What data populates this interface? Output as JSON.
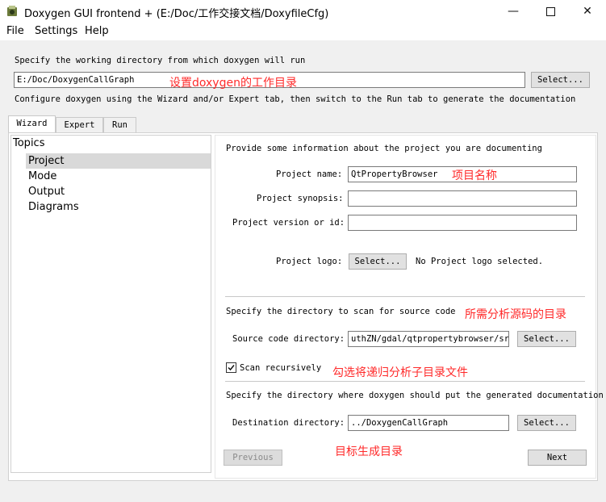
{
  "window": {
    "title": "Doxygen GUI frontend + (E:/Doc/工作交接文档/DoxyfileCfg)"
  },
  "menu": {
    "items": [
      "File",
      "Settings",
      "Help"
    ]
  },
  "workdir": {
    "label": "Specify the working directory from which doxygen will run",
    "value": "E:/Doc/DoxygenCallGraph",
    "select_label": "Select...",
    "annotation": "设置doxygen的工作目录"
  },
  "configure_hint": "Configure doxygen using the Wizard and/or Expert tab, then switch to the Run tab to generate the documentation",
  "tabs": [
    "Wizard",
    "Expert",
    "Run"
  ],
  "topics": {
    "header": "Topics",
    "items": [
      "Project",
      "Mode",
      "Output",
      "Diagrams"
    ]
  },
  "project": {
    "intro": "Provide some information about the project you are documenting",
    "name_label": "Project name:",
    "name_value": "QtPropertyBrowser",
    "name_annotation": "项目名称",
    "synopsis_label": "Project synopsis:",
    "synopsis_value": "",
    "version_label": "Project version or id:",
    "version_value": "",
    "logo_label": "Project logo:",
    "logo_select": "Select...",
    "logo_status": "No Project logo selected."
  },
  "source": {
    "intro": "Specify the directory to scan for source code",
    "annotation": "所需分析源码的目录",
    "label": "Source code directory:",
    "value": "uthZN/gdal/qtpropertybrowser/src",
    "select_label": "Select...",
    "scan_label": "Scan recursively",
    "scan_checked": true,
    "scan_annotation": "勾选将递归分析子目录文件"
  },
  "destination": {
    "intro": "Specify the directory where doxygen should put the generated documentation",
    "label": "Destination directory:",
    "value": "../DoxygenCallGraph",
    "select_label": "Select...",
    "annotation": "目标生成目录"
  },
  "nav": {
    "previous": "Previous",
    "next": "Next"
  }
}
